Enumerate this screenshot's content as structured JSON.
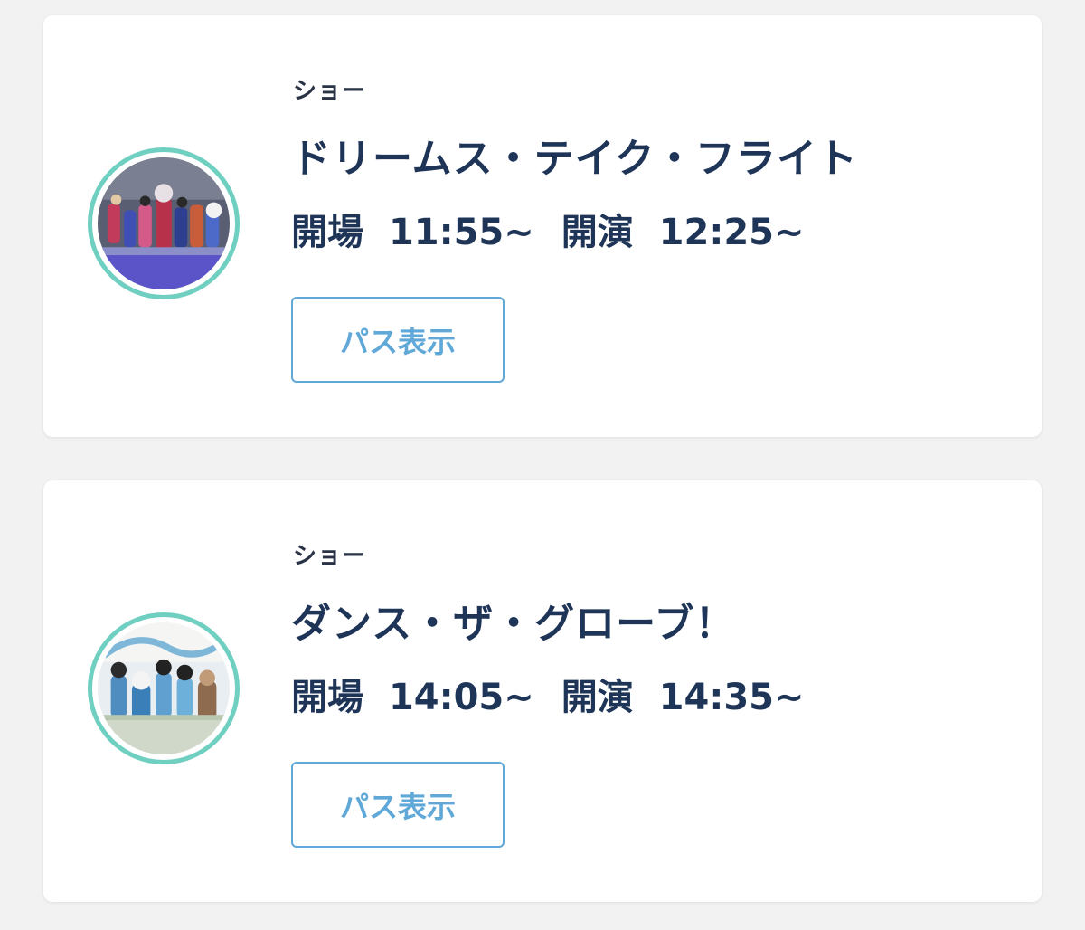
{
  "passes": [
    {
      "category": "ショー",
      "title": "ドリームス・テイク・フライト",
      "open_label": "開場",
      "open_time": "11:55~",
      "start_label": "開演",
      "start_time": "12:25~",
      "button_label": "パス表示",
      "thumbnail": "show-photo-dreams-take-flight"
    },
    {
      "category": "ショー",
      "title": "ダンス・ザ・グローブ！",
      "open_label": "開場",
      "open_time": "14:05~",
      "start_label": "開演",
      "start_time": "14:35~",
      "button_label": "パス表示",
      "thumbnail": "show-photo-dance-the-globe"
    }
  ],
  "colors": {
    "thumbnail_ring": "#6fcfc0",
    "title_text": "#1f3558",
    "button_accent": "#5fa8d8",
    "background": "#f2f2f3"
  }
}
